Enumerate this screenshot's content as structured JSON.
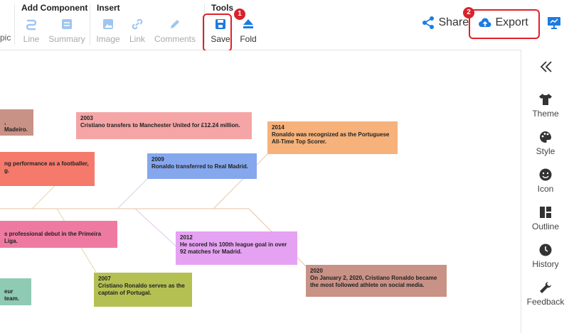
{
  "toolbar": {
    "groups": {
      "add_component": "Add Component",
      "insert": "Insert",
      "tools": "Tools"
    },
    "partial_left_label": "pic",
    "line_label": "Line",
    "summary_label": "Summary",
    "image_label": "Image",
    "link_label": "Link",
    "comments_label": "Comments",
    "save_label": "Save",
    "fold_label": "Fold",
    "share_label": "Share",
    "export_label": "Export",
    "badge_save": "1",
    "badge_export": "2"
  },
  "sidebar": {
    "items": [
      {
        "label": "Theme",
        "icon": "shirt-icon"
      },
      {
        "label": "Style",
        "icon": "palette-icon"
      },
      {
        "label": "Icon",
        "icon": "smiley-icon"
      },
      {
        "label": "Outline",
        "icon": "outline-icon"
      },
      {
        "label": "History",
        "icon": "clock-icon"
      },
      {
        "label": "Feedback",
        "icon": "wrench-icon"
      }
    ],
    "collapse_icon": "double-chevron-left-icon"
  },
  "canvas": {
    "nodes": [
      {
        "year": "",
        "text": ", Madeiro."
      },
      {
        "year": "2003",
        "text": "Cristiano transfers to Manchester United for £12.24 million."
      },
      {
        "year": "2014",
        "text": "Ronaldo was recognized as the Portuguese All-Time Top Scorer."
      },
      {
        "year": "2009",
        "text": "Ronaldo transferred to Real Madrid."
      },
      {
        "year": "",
        "text": "ng performance as a footballer, g."
      },
      {
        "year": "",
        "text": "s professional debut in the Primeira Liga."
      },
      {
        "year": "2012",
        "text": "He scored his 100th league goal in over 92 matches for Madrid."
      },
      {
        "year": "2020",
        "text": "On January 2, 2020, Cristiano Ronaldo became the most followed athlete on social media."
      },
      {
        "year": "2007",
        "text": "Cristiano Ronaldo serves as the captain of Portugal."
      },
      {
        "year": "",
        "text": "eur team."
      }
    ]
  },
  "colors": {
    "accent_blue": "#1e7be0",
    "highlight_red": "#e0202a"
  }
}
